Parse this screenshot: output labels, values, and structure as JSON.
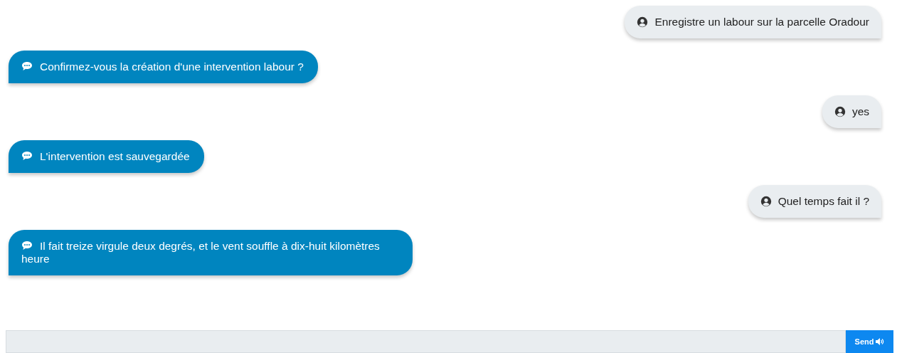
{
  "messages": [
    {
      "kind": "user",
      "text": "Enregistre un labour sur la parcelle Oradour"
    },
    {
      "kind": "bot",
      "text": "Confirmez-vous la création d'une intervention labour ?"
    },
    {
      "kind": "user",
      "text": "yes"
    },
    {
      "kind": "bot",
      "text": "L'intervention est sauvegardée"
    },
    {
      "kind": "user",
      "text": "Quel temps fait il ?"
    },
    {
      "kind": "bot",
      "text": "Il fait treize virgule deux degrés, et le vent souffle à dix-huit kilomètres heure"
    }
  ],
  "composer": {
    "send_label": "Send"
  }
}
